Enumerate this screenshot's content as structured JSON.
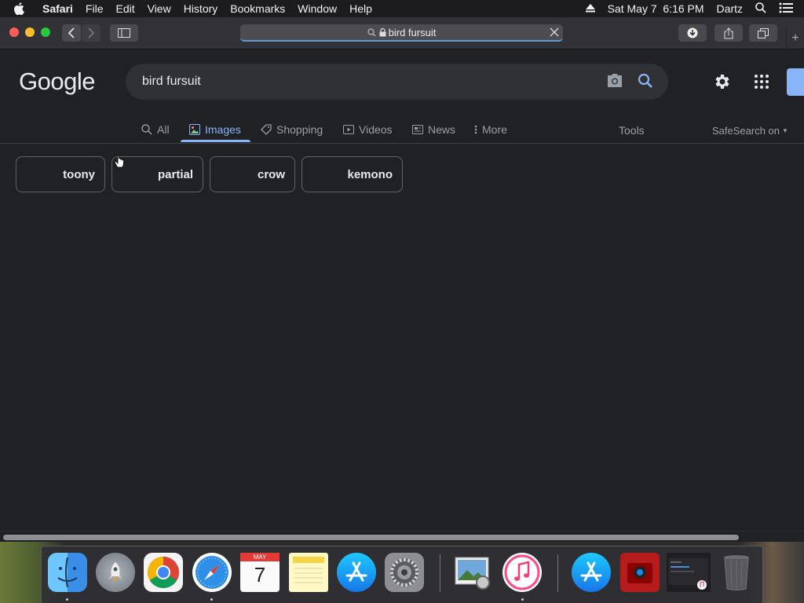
{
  "menubar": {
    "app_name": "Safari",
    "menus": [
      "File",
      "Edit",
      "View",
      "History",
      "Bookmarks",
      "Window",
      "Help"
    ],
    "datetime": "Sat May 7  6:16 PM",
    "user": "Dartz"
  },
  "browser": {
    "url_text": "bird fursuit"
  },
  "google": {
    "logo": "Google",
    "query": "bird fursuit",
    "tabs": [
      {
        "label": "All",
        "icon": "search-icon"
      },
      {
        "label": "Images",
        "icon": "image-icon",
        "active": true
      },
      {
        "label": "Shopping",
        "icon": "tag-icon"
      },
      {
        "label": "Videos",
        "icon": "play-icon"
      },
      {
        "label": "News",
        "icon": "news-icon"
      },
      {
        "label": "More",
        "icon": "more-vert-icon"
      }
    ],
    "tools": "Tools",
    "safesearch": "SafeSearch on",
    "chips": [
      "toony",
      "partial",
      "crow",
      "kemono"
    ]
  },
  "dock": {
    "apps": [
      "Finder",
      "Launchpad",
      "Google Chrome",
      "Safari",
      "Calendar",
      "Notes",
      "App Store",
      "System Preferences",
      "Preview",
      "iTunes",
      "App Store",
      "Photo Booth",
      "Screenshot",
      "Trash"
    ],
    "calendar_month": "MAY",
    "calendar_day": "7"
  },
  "colors": {
    "background": "#202124",
    "accent": "#8ab4f8",
    "search_box": "#303134"
  }
}
